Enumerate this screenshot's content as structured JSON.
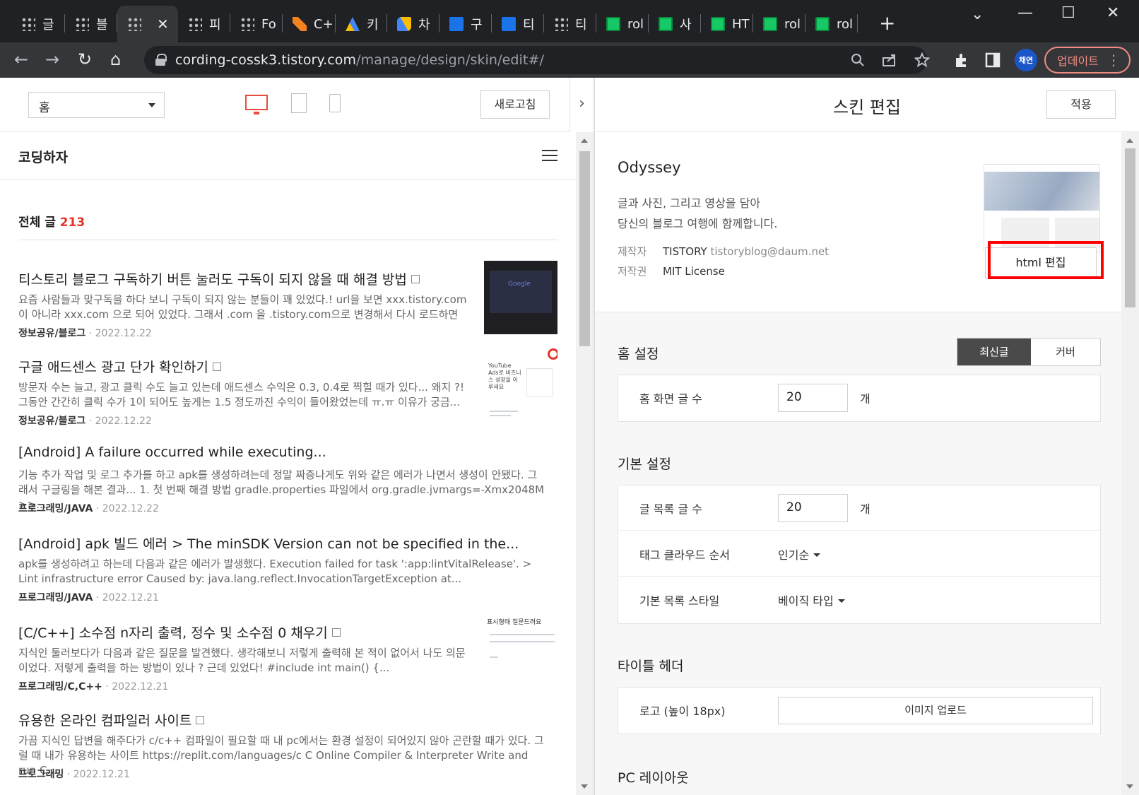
{
  "browser": {
    "tabs": [
      {
        "label": "글",
        "fav": "dots"
      },
      {
        "label": "블",
        "fav": "dots"
      },
      {
        "label": "",
        "fav": "dots",
        "active": true
      },
      {
        "label": "피",
        "fav": "dots"
      },
      {
        "label": "Fo",
        "fav": "dots"
      },
      {
        "label": "C+",
        "fav": "orange"
      },
      {
        "label": "키",
        "fav": "ads"
      },
      {
        "label": "차",
        "fav": "adsense"
      },
      {
        "label": "구",
        "fav": "blue"
      },
      {
        "label": "티",
        "fav": "blue"
      },
      {
        "label": "티",
        "fav": "dots"
      },
      {
        "label": "rol",
        "fav": "green"
      },
      {
        "label": "사",
        "fav": "green"
      },
      {
        "label": "HT",
        "fav": "green"
      },
      {
        "label": "rol",
        "fav": "green"
      },
      {
        "label": "rol",
        "fav": "green"
      }
    ],
    "close_glyph": "✕",
    "new_tab_glyph": "+",
    "window_controls": {
      "chevron": "⌄",
      "minimize": "—",
      "maximize": "☐",
      "close": "✕"
    },
    "nav": {
      "back": "←",
      "forward": "→",
      "reload": "↻",
      "home": "⌂"
    },
    "url_host": "cording-cossk3.tistory.com",
    "url_path": "/manage/design/skin/edit#/",
    "profile_initials": "채연",
    "update_label": "업데이트",
    "menu_glyph": "⋮"
  },
  "left": {
    "page_select": "홈",
    "refresh_label": "새로고침",
    "collapse_glyph": "›",
    "blog_name": "코딩하자",
    "total_label": "전체 글",
    "total_count": "213",
    "posts": [
      {
        "title": "티스토리 블로그 구독하기 버튼 눌러도 구독이 되지 않을 때 해결 방법",
        "excerpt": "요즘 사람들과 맞구독을 하다 보니 구독이 되지 않는 분들이 꽤 있었다.! url을 보면 xxx.tistory.com 이 아니라 xxx.com 으로 되어 있었다. 그래서 .com 을 .tistory.com으로 변경해서 다시 로드하면 ...",
        "category": "정보공유/블로그",
        "date": "2022.12.22"
      },
      {
        "title": "구글 애드센스 광고 단가 확인하기",
        "excerpt": "방문자 수는 늘고, 광고 클릭 수도 늘고 있는데 애드센스 수익은 0.3, 0.4로 찍힐 때가 있다... 왜지 ?! 그동안 간간히 클릭 수가 1이 되어도 높게는 1.5 정도까진 수익이 들어왔었는데 ㅠ.ㅠ 이유가 궁금...",
        "category": "정보공유/블로그",
        "date": "2022.12.22"
      },
      {
        "title": "[Android] A failure occurred while executing...",
        "excerpt": "기능 추가 작업 및 로그 추가를 하고 apk를 생성하려는데 정말 짜증나게도 위와 같은 에러가 나면서 생성이 안됐다. 그래서 구글링을 해본 결과... 1. 첫 번째 해결 방법 gradle.properties 파일에서 org.gradle.jvmargs=-Xmx2048M >>...",
        "category": "프로그래밍/JAVA",
        "date": "2022.12.22"
      },
      {
        "title": "[Android] apk 빌드 에러 > The minSDK Version can not be specified in the...",
        "excerpt": "apk를 생성하려고 하는데 다음과 같은 에러가 발생했다. Execution failed for task ':app:lintVitalRelease'. > Lint infrastructure error Caused by: java.lang.reflect.InvocationTargetException at...",
        "category": "프로그래밍/JAVA",
        "date": "2022.12.21"
      },
      {
        "title": "[C/C++] 소수점 n자리 출력, 정수 및 소수점 0 채우기",
        "excerpt": "지식인 둘러보다가 다음과 같은 질문을 발견했다. 생각해보니 저렇게 출력해 본 적이 없어서 나도 의문이었다. 저렇게 출력을 하는 방법이 있나 ? 근데 있었다! #include int main() {...",
        "category": "프로그래밍/C,C++",
        "date": "2022.12.21"
      },
      {
        "title": "유용한 온라인 컴파일러 사이트",
        "excerpt": "가끔 지식인 답변을 해주다가 c/c++ 컴파일이 필요할 때 내 pc에서는 환경 설정이 되어있지 않아 곤란할 때가 있다. 그럴 때 내가 유용하는 사이트 https://replit.com/languages/c C Online Compiler & Interpreter Write and run C...",
        "category": "프로그래밍",
        "date": "2022.12.21"
      }
    ],
    "meta_sep": "·",
    "thumb_text": {
      "google": "Google",
      "adsense": "YouTube Ads로 비즈니스 성장을 이루세요",
      "question": "표시형태 질문드려요"
    }
  },
  "right": {
    "title": "스킨 편집",
    "apply_label": "적용",
    "skin": {
      "name": "Odyssey",
      "desc_line1": "글과 사진, 그리고 영상을 담아",
      "desc_line2": "당신의 블로그 여행에 함께합니다.",
      "author_label": "제작자",
      "author_name": "TISTORY",
      "author_email": "tistoryblog@daum.net",
      "license_label": "저작권",
      "license": "MIT License",
      "html_edit_label": "html 편집"
    },
    "home": {
      "title": "홈 설정",
      "seg_latest": "최신글",
      "seg_cover": "커버",
      "count_label": "홈 화면 글 수",
      "count_value": "20",
      "unit": "개"
    },
    "basic": {
      "title": "기본 설정",
      "list_label": "글 목록 글 수",
      "list_value": "20",
      "unit": "개",
      "tag_label": "태그 클라우드 순서",
      "tag_value": "인기순",
      "style_label": "기본 목록 스타일",
      "style_value": "베이직 타입"
    },
    "title_header": {
      "title": "타이틀 헤더",
      "logo_label": "로고 (높이 18px)",
      "upload_label": "이미지 업로드"
    },
    "pc_layout_title": "PC 레이아웃"
  },
  "colors": {
    "accent": "#e5332a",
    "highlight": "#ff0000",
    "update": "#f28b82"
  }
}
